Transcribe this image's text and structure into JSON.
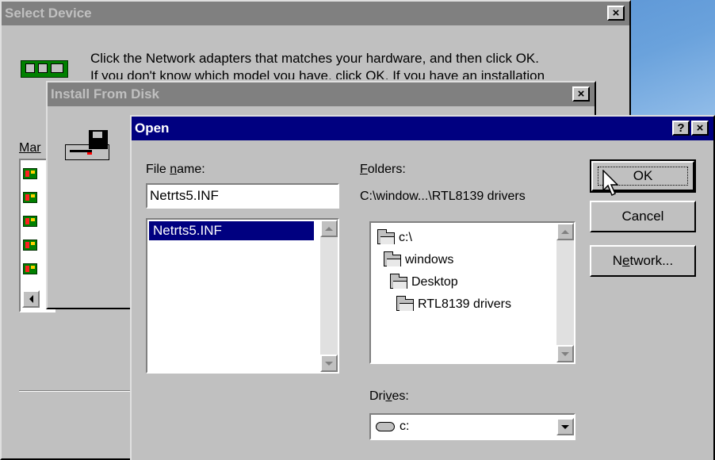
{
  "select_device": {
    "title": "Select Device",
    "close": "×",
    "message_line1": "Click the Network adapters that matches your hardware, and then click OK.",
    "message_line2": "If you don't know which model you have, click OK. If you have an installation",
    "manufacturers_label_partial": "Mar"
  },
  "install_from_disk": {
    "title": "Install From Disk",
    "close": "×"
  },
  "open_dialog": {
    "title": "Open",
    "help": "?",
    "close": "×",
    "file_name_label_pre": "File ",
    "file_name_label_access": "n",
    "file_name_label_post": "ame:",
    "file_name_value": "Netrts5.INF",
    "file_list": [
      "Netrts5.INF"
    ],
    "folders_label_access": "F",
    "folders_label_post": "olders:",
    "current_path": "C:\\window...\\RTL8139 drivers",
    "folders": [
      "c:\\",
      "windows",
      "Desktop",
      "RTL8139 drivers"
    ],
    "drives_label_pre": "Dri",
    "drives_label_access": "v",
    "drives_label_post": "es:",
    "drive_value": "c:",
    "ok_label": "OK",
    "cancel_label": "Cancel",
    "network_label_pre": "N",
    "network_label_access": "e",
    "network_label_post": "twork..."
  },
  "colors": {
    "face": "#c0c0c0",
    "active_title": "#000080",
    "inactive_title": "#808080",
    "selection": "#000080"
  }
}
